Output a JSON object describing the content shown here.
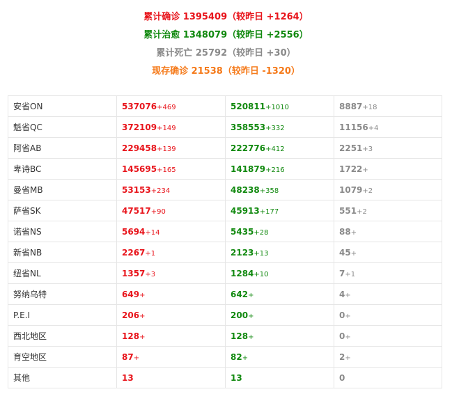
{
  "summary": {
    "total_confirmed": "累计确诊 1395409（较昨日 +1264）",
    "total_cured": "累计治愈 1348079（较昨日 +2556）",
    "total_deaths": "累计死亡 25792（较昨日 +30）",
    "current_confirmed": "现存确诊 21538（较昨日 -1320）"
  },
  "colors": {
    "confirmed": "#e8141b",
    "cured": "#11890f",
    "deaths": "#8a8a8a",
    "current": "#f57a1a",
    "border": "#e6e6e6"
  },
  "rows": [
    {
      "region": "安省ON",
      "confirmed": "537076",
      "confirmed_inc": "+469",
      "cured": "520811",
      "cured_inc": "+1010",
      "deaths": "8887",
      "deaths_inc": "+18"
    },
    {
      "region": "魁省QC",
      "confirmed": "372109",
      "confirmed_inc": "+149",
      "cured": "358553",
      "cured_inc": "+332",
      "deaths": "11156",
      "deaths_inc": "+4"
    },
    {
      "region": "阿省AB",
      "confirmed": "229458",
      "confirmed_inc": "+139",
      "cured": "222776",
      "cured_inc": "+412",
      "deaths": "2251",
      "deaths_inc": "+3"
    },
    {
      "region": "卑诗BC",
      "confirmed": "145695",
      "confirmed_inc": "+165",
      "cured": "141879",
      "cured_inc": "+216",
      "deaths": "1722",
      "deaths_inc": "+"
    },
    {
      "region": "曼省MB",
      "confirmed": "53153",
      "confirmed_inc": "+234",
      "cured": "48238",
      "cured_inc": "+358",
      "deaths": "1079",
      "deaths_inc": "+2"
    },
    {
      "region": "萨省SK",
      "confirmed": "47517",
      "confirmed_inc": "+90",
      "cured": "45913",
      "cured_inc": "+177",
      "deaths": "551",
      "deaths_inc": "+2"
    },
    {
      "region": "诺省NS",
      "confirmed": "5694",
      "confirmed_inc": "+14",
      "cured": "5435",
      "cured_inc": "+28",
      "deaths": "88",
      "deaths_inc": "+"
    },
    {
      "region": "新省NB",
      "confirmed": "2267",
      "confirmed_inc": "+1",
      "cured": "2123",
      "cured_inc": "+13",
      "deaths": "45",
      "deaths_inc": "+"
    },
    {
      "region": "纽省NL",
      "confirmed": "1357",
      "confirmed_inc": "+3",
      "cured": "1284",
      "cured_inc": "+10",
      "deaths": "7",
      "deaths_inc": "+1"
    },
    {
      "region": "努纳乌特",
      "confirmed": "649",
      "confirmed_inc": "+",
      "cured": "642",
      "cured_inc": "+",
      "deaths": "4",
      "deaths_inc": "+"
    },
    {
      "region": "P.E.I",
      "confirmed": "206",
      "confirmed_inc": "+",
      "cured": "200",
      "cured_inc": "+",
      "deaths": "0",
      "deaths_inc": "+"
    },
    {
      "region": "西北地区",
      "confirmed": "128",
      "confirmed_inc": "+",
      "cured": "128",
      "cured_inc": "+",
      "deaths": "0",
      "deaths_inc": "+"
    },
    {
      "region": "育空地区",
      "confirmed": "87",
      "confirmed_inc": "+",
      "cured": "82",
      "cured_inc": "+",
      "deaths": "2",
      "deaths_inc": "+"
    },
    {
      "region": "其他",
      "confirmed": "13",
      "confirmed_inc": "",
      "cured": "13",
      "cured_inc": "",
      "deaths": "0",
      "deaths_inc": ""
    }
  ]
}
